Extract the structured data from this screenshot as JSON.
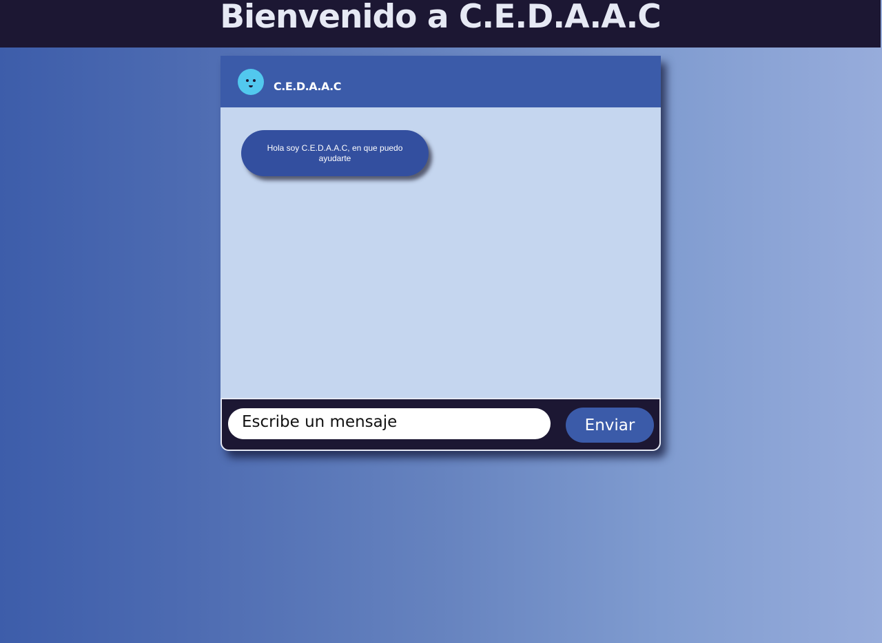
{
  "page": {
    "heading": "Bienvenido a C.E.D.A.A.C"
  },
  "chat": {
    "header": {
      "name": "C.E.D.A.A.C",
      "avatar_icon": "smiley-face-icon"
    },
    "messages": [
      {
        "sender": "bot",
        "text": "Hola soy C.E.D.A.A.C, en que puedo ayudarte"
      }
    ],
    "input": {
      "placeholder": "Escribe un mensaje",
      "value": ""
    },
    "send_label": "Enviar"
  },
  "colors": {
    "top_bar": "#1c1733",
    "header": "#3b5ba9",
    "chat_background": "#c5d6ef",
    "bot_bubble": "#334f9f",
    "avatar": "#52c8ee",
    "send_button": "#3b5ba9"
  }
}
